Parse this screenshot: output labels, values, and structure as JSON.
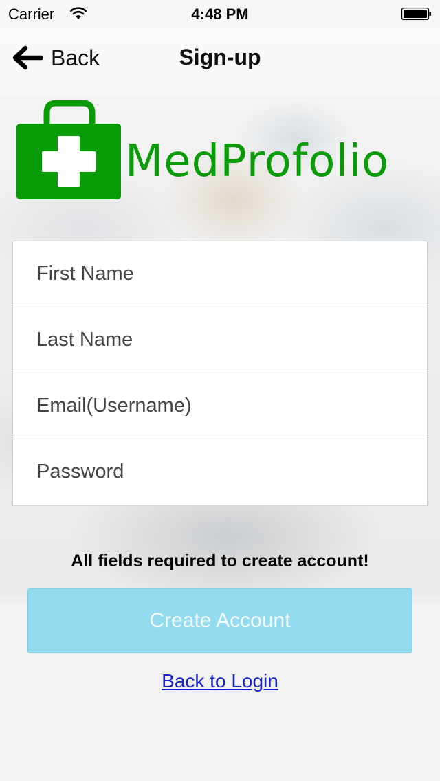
{
  "status_bar": {
    "carrier": "Carrier",
    "time": "4:48 PM"
  },
  "nav": {
    "back_label": "Back",
    "title": "Sign-up"
  },
  "logo": {
    "text": "MedProfolio",
    "color": "#0a9b08"
  },
  "form": {
    "fields": [
      {
        "placeholder": "First Name",
        "value": ""
      },
      {
        "placeholder": "Last Name",
        "value": ""
      },
      {
        "placeholder": "Email(Username)",
        "value": ""
      },
      {
        "placeholder": "Password",
        "value": ""
      }
    ]
  },
  "notice": "All fields required to create account!",
  "create_button": {
    "label": "Create Account",
    "color": "#93dcf0"
  },
  "back_to_login": "Back to Login",
  "icons": {
    "back": "arrow-left-icon",
    "wifi": "wifi-icon",
    "battery": "battery-icon",
    "logo": "medical-bag-icon"
  }
}
